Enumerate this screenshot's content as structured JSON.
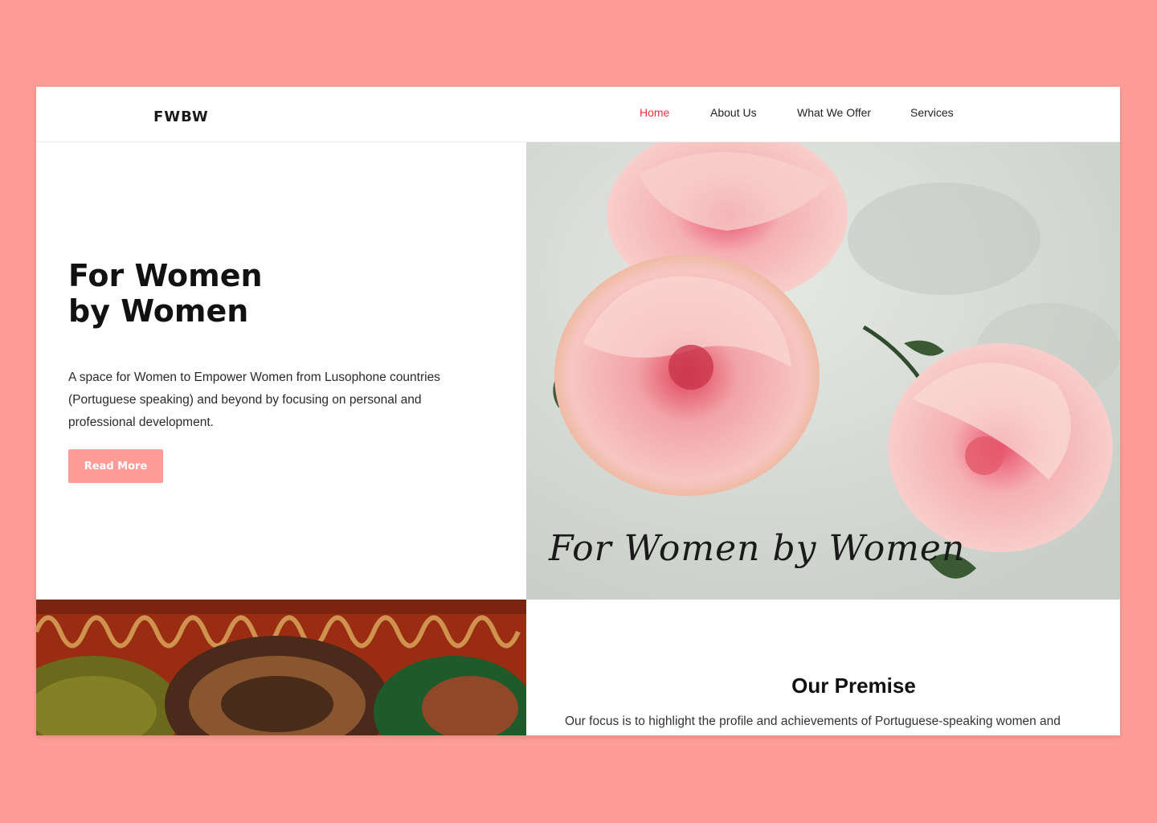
{
  "brand": {
    "logo": "FWBW",
    "accent": "#e8333a",
    "pink": "#ff9c97"
  },
  "nav": {
    "items": [
      {
        "label": "Home",
        "active": true
      },
      {
        "label": "About Us",
        "active": false
      },
      {
        "label": "What We Offer",
        "active": false
      },
      {
        "label": "Services",
        "active": false
      }
    ]
  },
  "hero": {
    "title_line1": "For Women",
    "title_line2": "by Women",
    "description": "A space for Women to Empower Women from Lusophone countries (Portuguese speaking) and beyond by focusing on personal and professional development.",
    "button_label": "Read More",
    "image_caption": "For Women by Women"
  },
  "premise": {
    "title": "Our Premise",
    "text": "Our focus is to highlight the profile and achievements of Portuguese-speaking women and"
  }
}
